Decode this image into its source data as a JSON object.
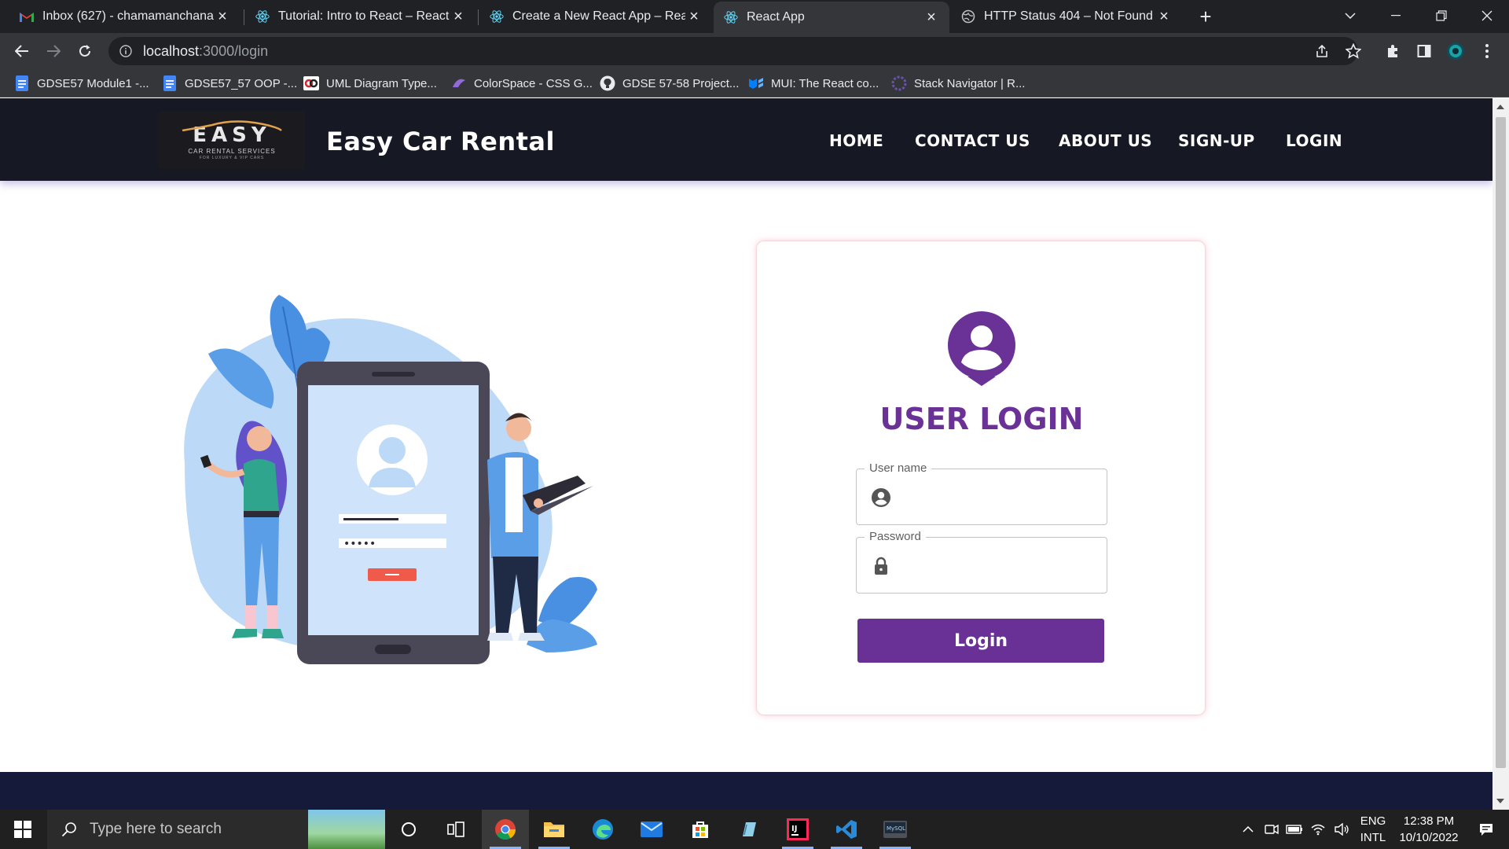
{
  "browser": {
    "tabs": [
      {
        "title": "Inbox (627) - chamamanchanayake",
        "icon": "gmail-icon",
        "active": false
      },
      {
        "title": "Tutorial: Intro to React – React",
        "icon": "react-icon",
        "active": false
      },
      {
        "title": "Create a New React App – React",
        "icon": "react-icon",
        "active": false
      },
      {
        "title": "React App",
        "icon": "react-icon",
        "active": true
      },
      {
        "title": "HTTP Status 404 – Not Found",
        "icon": "globe-icon",
        "active": false
      }
    ],
    "url_host": "localhost",
    "url_path": ":3000/login",
    "bookmarks": [
      {
        "label": "GDSE57 Module1 -...",
        "icon": "docs-icon"
      },
      {
        "label": "GDSE57_57 OOP -...",
        "icon": "docs-icon"
      },
      {
        "label": "UML Diagram Type...",
        "icon": "vp-icon"
      },
      {
        "label": "ColorSpace - CSS G...",
        "icon": "colorspace-icon"
      },
      {
        "label": "GDSE 57-58 Project...",
        "icon": "github-icon"
      },
      {
        "label": "MUI: The React co...",
        "icon": "mui-icon"
      },
      {
        "label": "Stack Navigator | R...",
        "icon": "react-navigation-icon"
      }
    ]
  },
  "site": {
    "logo": {
      "word": "EASY",
      "sub": "CAR RENTAL SERVICES",
      "sub2": "FOR LUXURY & VIP CARS"
    },
    "brand": "Easy Car Rental",
    "nav": [
      "HOME",
      "CONTACT US",
      "ABOUT US",
      "SIGN-UP",
      "LOGIN"
    ]
  },
  "login": {
    "title": "USER LOGIN",
    "username_label": "User name",
    "username_value": "",
    "password_label": "Password",
    "password_value": "",
    "button": "Login"
  },
  "taskbar": {
    "search_placeholder": "Type here to search",
    "lang_top": "ENG",
    "lang_bottom": "INTL",
    "time": "12:38 PM",
    "date": "10/10/2022"
  },
  "colors": {
    "header_bg": "#161824",
    "accent_purple": "#693196",
    "footer_bg": "#161a3a",
    "illustration_blue": "#4a90e2"
  }
}
